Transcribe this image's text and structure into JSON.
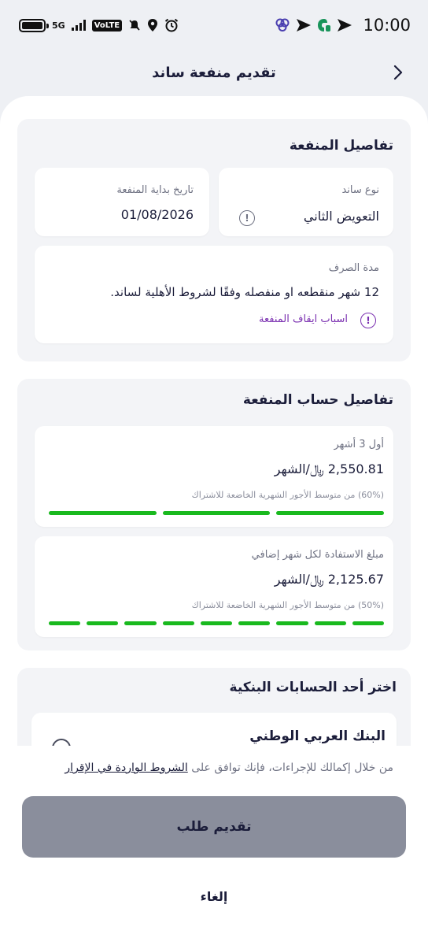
{
  "status_bar": {
    "network": "5G",
    "volte": "VoLTE",
    "time": "10:00"
  },
  "header": {
    "title": "تقديم منفعة ساند",
    "back_icon": "chevron-right-icon"
  },
  "benefit_details": {
    "title": "تفاصيل المنفعة",
    "type_label": "نوع ساند",
    "type_value": "التعويض الثاني",
    "start_label": "تاريخ بداية المنفعة",
    "start_value": "01/08/2026",
    "duration_label": "مدة الصرف",
    "duration_value": "12 شهر منقطعه او منفصله وفقًا لشروط الأهلية لساند.",
    "stop_reasons_link": "اسباب ايقاف المنفعة"
  },
  "calculation": {
    "title": "تفاصيل حساب المنفعة",
    "first": {
      "label": "أول 3 أشهر",
      "amount": "2,550.81 ﷼/الشهر",
      "note": "(60%) من متوسط الأجور الشهرية الخاضعة للاشتراك",
      "segments": 3
    },
    "second": {
      "label": "مبلغ الاستفادة لكل شهر إضافي",
      "amount": "2,125.67 ﷼/الشهر",
      "note": "(50%) من متوسط الأجور الشهرية الخاضعة للاشتراك",
      "segments": 9
    },
    "bar_color": "#19b91e"
  },
  "bank_accounts": {
    "title": "اختر أحد الحسابات البنكية",
    "bank_name": "البنك العربي الوطني"
  },
  "footer": {
    "consent_prefix": "من خلال إكمالك للإجراءات، فإنك توافق على ",
    "consent_link": "الشروط الواردة في الإقرار",
    "submit_label": "تقديم طلب",
    "cancel_label": "إلغاء"
  }
}
